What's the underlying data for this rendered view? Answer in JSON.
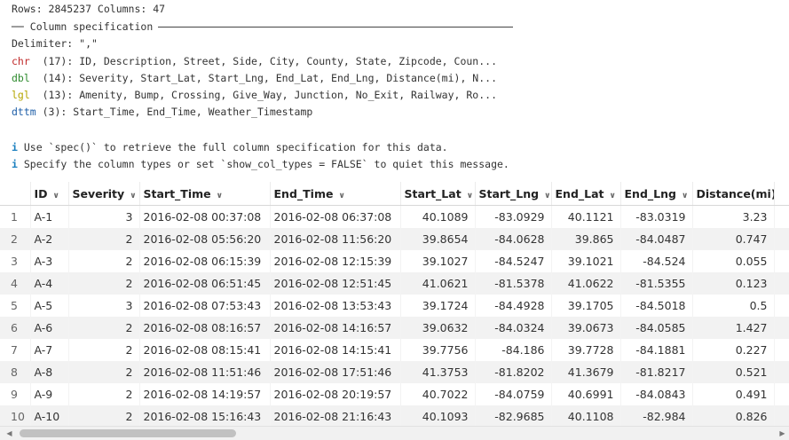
{
  "console": {
    "rows_label": "Rows: 2845237 Columns: 47",
    "spec_header": "── Column specification",
    "delimiter": "Delimiter: \",\"",
    "types": [
      {
        "tag": "chr",
        "count": " (17):",
        "cols": "ID, Description, Street, Side, City, County, State, Zipcode, Coun...",
        "cls": "t-chr",
        "tagpad": "chr "
      },
      {
        "tag": "dbl",
        "count": " (14):",
        "cols": "Severity, Start_Lat, Start_Lng, End_Lat, End_Lng, Distance(mi), N...",
        "cls": "t-dbl",
        "tagpad": "dbl "
      },
      {
        "tag": "lgl",
        "count": " (13):",
        "cols": "Amenity, Bump, Crossing, Give_Way, Junction, No_Exit, Railway, Ro...",
        "cls": "t-lgl",
        "tagpad": "lgl "
      },
      {
        "tag": "dttm",
        "count": " (3):",
        "cols": "Start_Time, End_Time, Weather_Timestamp",
        "cls": "t-dttm",
        "tagpad": "dttm"
      }
    ],
    "info": [
      {
        "icon": "i",
        "text": "Use `spec()` to retrieve the full column specification for this data."
      },
      {
        "icon": "i",
        "text": "Specify the column types or set `show_col_types = FALSE` to quiet this message."
      }
    ]
  },
  "table": {
    "columns": [
      "ID",
      "Severity",
      "Start_Time",
      "End_Time",
      "Start_Lat",
      "Start_Lng",
      "End_Lat",
      "End_Lng",
      "Distance(mi)"
    ],
    "rows": [
      [
        "1",
        "A-1",
        "3",
        "2016-02-08 00:37:08",
        "2016-02-08 06:37:08",
        "40.1089",
        "-83.0929",
        "40.1121",
        "-83.0319",
        "3.23"
      ],
      [
        "2",
        "A-2",
        "2",
        "2016-02-08 05:56:20",
        "2016-02-08 11:56:20",
        "39.8654",
        "-84.0628",
        "39.865",
        "-84.0487",
        "0.747"
      ],
      [
        "3",
        "A-3",
        "2",
        "2016-02-08 06:15:39",
        "2016-02-08 12:15:39",
        "39.1027",
        "-84.5247",
        "39.1021",
        "-84.524",
        "0.055"
      ],
      [
        "4",
        "A-4",
        "2",
        "2016-02-08 06:51:45",
        "2016-02-08 12:51:45",
        "41.0621",
        "-81.5378",
        "41.0622",
        "-81.5355",
        "0.123"
      ],
      [
        "5",
        "A-5",
        "3",
        "2016-02-08 07:53:43",
        "2016-02-08 13:53:43",
        "39.1724",
        "-84.4928",
        "39.1705",
        "-84.5018",
        "0.5"
      ],
      [
        "6",
        "A-6",
        "2",
        "2016-02-08 08:16:57",
        "2016-02-08 14:16:57",
        "39.0632",
        "-84.0324",
        "39.0673",
        "-84.0585",
        "1.427"
      ],
      [
        "7",
        "A-7",
        "2",
        "2016-02-08 08:15:41",
        "2016-02-08 14:15:41",
        "39.7756",
        "-84.186",
        "39.7728",
        "-84.1881",
        "0.227"
      ],
      [
        "8",
        "A-8",
        "2",
        "2016-02-08 11:51:46",
        "2016-02-08 17:51:46",
        "41.3753",
        "-81.8202",
        "41.3679",
        "-81.8217",
        "0.521"
      ],
      [
        "9",
        "A-9",
        "2",
        "2016-02-08 14:19:57",
        "2016-02-08 20:19:57",
        "40.7022",
        "-84.0759",
        "40.6991",
        "-84.0843",
        "0.491"
      ],
      [
        "10",
        "A-10",
        "2",
        "2016-02-08 15:16:43",
        "2016-02-08 21:16:43",
        "40.1093",
        "-82.9685",
        "40.1108",
        "-82.984",
        "0.826"
      ]
    ]
  },
  "scrollbar": {
    "left_arrow": "◀",
    "right_arrow": "▶"
  }
}
